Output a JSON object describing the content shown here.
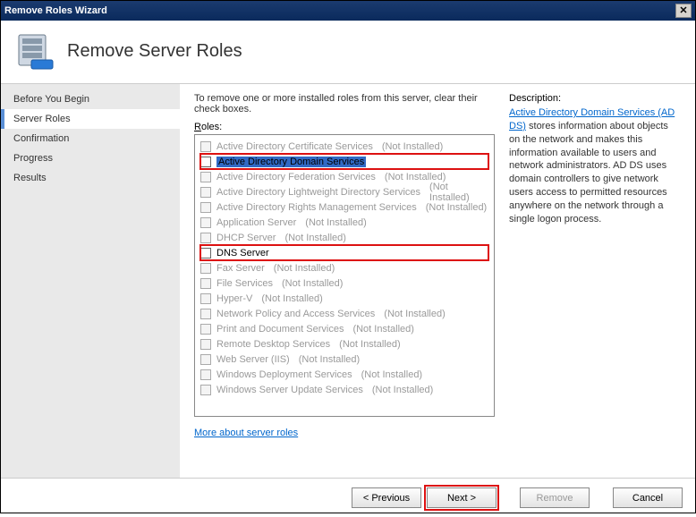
{
  "titlebar": {
    "title": "Remove Roles Wizard",
    "close_glyph": "✕"
  },
  "header": {
    "title": "Remove Server Roles"
  },
  "sidebar": {
    "items": [
      {
        "label": "Before You Begin"
      },
      {
        "label": "Server Roles"
      },
      {
        "label": "Confirmation"
      },
      {
        "label": "Progress"
      },
      {
        "label": "Results"
      }
    ]
  },
  "main": {
    "instruction": "To remove one or more installed roles from this server, clear their check boxes.",
    "roles_label": "Roles:",
    "roles": [
      {
        "name": "Active Directory Certificate Services",
        "status": "(Not Installed)",
        "enabled": false,
        "highlight": false,
        "selected": false
      },
      {
        "name": "Active Directory Domain Services",
        "status": "",
        "enabled": true,
        "highlight": true,
        "selected": true
      },
      {
        "name": "Active Directory Federation Services",
        "status": "(Not Installed)",
        "enabled": false,
        "highlight": false,
        "selected": false
      },
      {
        "name": "Active Directory Lightweight Directory Services",
        "status": "(Not Installed)",
        "enabled": false,
        "highlight": false,
        "selected": false
      },
      {
        "name": "Active Directory Rights Management Services",
        "status": "(Not Installed)",
        "enabled": false,
        "highlight": false,
        "selected": false
      },
      {
        "name": "Application Server",
        "status": "(Not Installed)",
        "enabled": false,
        "highlight": false,
        "selected": false
      },
      {
        "name": "DHCP Server",
        "status": "(Not Installed)",
        "enabled": false,
        "highlight": false,
        "selected": false
      },
      {
        "name": "DNS Server",
        "status": "",
        "enabled": true,
        "highlight": true,
        "selected": false
      },
      {
        "name": "Fax Server",
        "status": "(Not Installed)",
        "enabled": false,
        "highlight": false,
        "selected": false
      },
      {
        "name": "File Services",
        "status": "(Not Installed)",
        "enabled": false,
        "highlight": false,
        "selected": false
      },
      {
        "name": "Hyper-V",
        "status": "(Not Installed)",
        "enabled": false,
        "highlight": false,
        "selected": false
      },
      {
        "name": "Network Policy and Access Services",
        "status": "(Not Installed)",
        "enabled": false,
        "highlight": false,
        "selected": false
      },
      {
        "name": "Print and Document Services",
        "status": "(Not Installed)",
        "enabled": false,
        "highlight": false,
        "selected": false
      },
      {
        "name": "Remote Desktop Services",
        "status": "(Not Installed)",
        "enabled": false,
        "highlight": false,
        "selected": false
      },
      {
        "name": "Web Server (IIS)",
        "status": "(Not Installed)",
        "enabled": false,
        "highlight": false,
        "selected": false
      },
      {
        "name": "Windows Deployment Services",
        "status": "(Not Installed)",
        "enabled": false,
        "highlight": false,
        "selected": false
      },
      {
        "name": "Windows Server Update Services",
        "status": "(Not Installed)",
        "enabled": false,
        "highlight": false,
        "selected": false
      }
    ],
    "more_link": "More about server roles"
  },
  "description": {
    "label": "Description:",
    "link_text": "Active Directory Domain Services (AD DS)",
    "body": " stores information about objects on the network and makes this information available to users and network administrators. AD DS uses domain controllers to give network users access to permitted resources anywhere on the network through a single logon process."
  },
  "footer": {
    "previous": "< Previous",
    "next": "Next >",
    "remove": "Remove",
    "cancel": "Cancel"
  }
}
